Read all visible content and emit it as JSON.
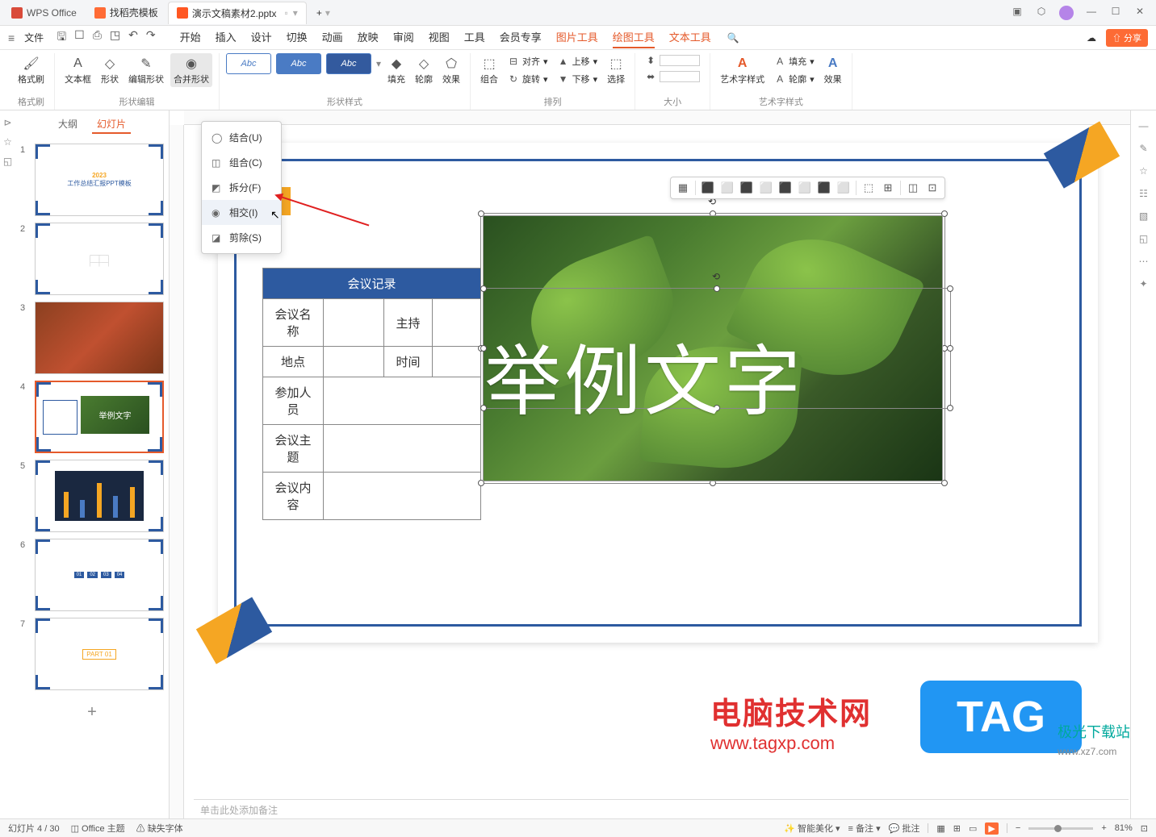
{
  "titlebar": {
    "app_name": "WPS Office",
    "tab1": "找稻壳模板",
    "tab2": "演示文稿素材2.pptx",
    "add": "+"
  },
  "menubar": {
    "file": "文件",
    "tabs": [
      "开始",
      "插入",
      "设计",
      "切换",
      "动画",
      "放映",
      "审阅",
      "视图",
      "工具",
      "会员专享"
    ],
    "ctx_tabs": [
      "图片工具",
      "绘图工具",
      "文本工具"
    ]
  },
  "ribbon": {
    "format_painter": "格式刷",
    "textbox": "文本框",
    "shape": "形状",
    "edit_shape": "编辑形状",
    "merge_shape": "合并形状",
    "group_shape_edit": "形状编辑",
    "abc": "Abc",
    "fill": "填充",
    "outline": "轮廓",
    "effect": "效果",
    "group_shape_style": "形状样式",
    "combine": "组合",
    "align": "对齐",
    "rotate": "旋转",
    "up": "上移",
    "down": "下移",
    "select": "选择",
    "group_arrange": "排列",
    "group_size": "大小",
    "art_style": "艺术字样式",
    "txt_fill": "填充",
    "txt_outline": "轮廓",
    "txt_effect": "效果",
    "group_art": "艺术字样式"
  },
  "dropdown": {
    "union": "结合(U)",
    "combine": "组合(C)",
    "fragment": "拆分(F)",
    "intersect": "相交(I)",
    "subtract": "剪除(S)"
  },
  "panel": {
    "outline": "大纲",
    "slides": "幻灯片"
  },
  "slide": {
    "table_title": "会议记录",
    "r1c1": "会议名称",
    "r1c2": "主持",
    "r2c1": "地点",
    "r2c2": "时间",
    "r3c1": "参加人员",
    "r4c1": "会议主题",
    "r5c1": "会议内容",
    "big_text": "举例文字"
  },
  "thumbs": {
    "t1_year": "2023",
    "t1_title": "工作总结汇报PPT模板",
    "t4_text": "举例文字",
    "t7_part": "PART 01"
  },
  "watermark": {
    "line1": "电脑技术网",
    "line2": "www.tagxp.com",
    "tag": "TAG",
    "logo1": "极光下载站",
    "logo2": "www.xz7.com"
  },
  "notes": {
    "placeholder": "单击此处添加备注"
  },
  "status": {
    "slide_pos": "幻灯片 4 / 30",
    "theme": "Office 主题",
    "missing_font": "缺失字体",
    "smart_beautify": "智能美化",
    "notes_btn": "备注",
    "comments": "批注",
    "zoom": "81%"
  }
}
